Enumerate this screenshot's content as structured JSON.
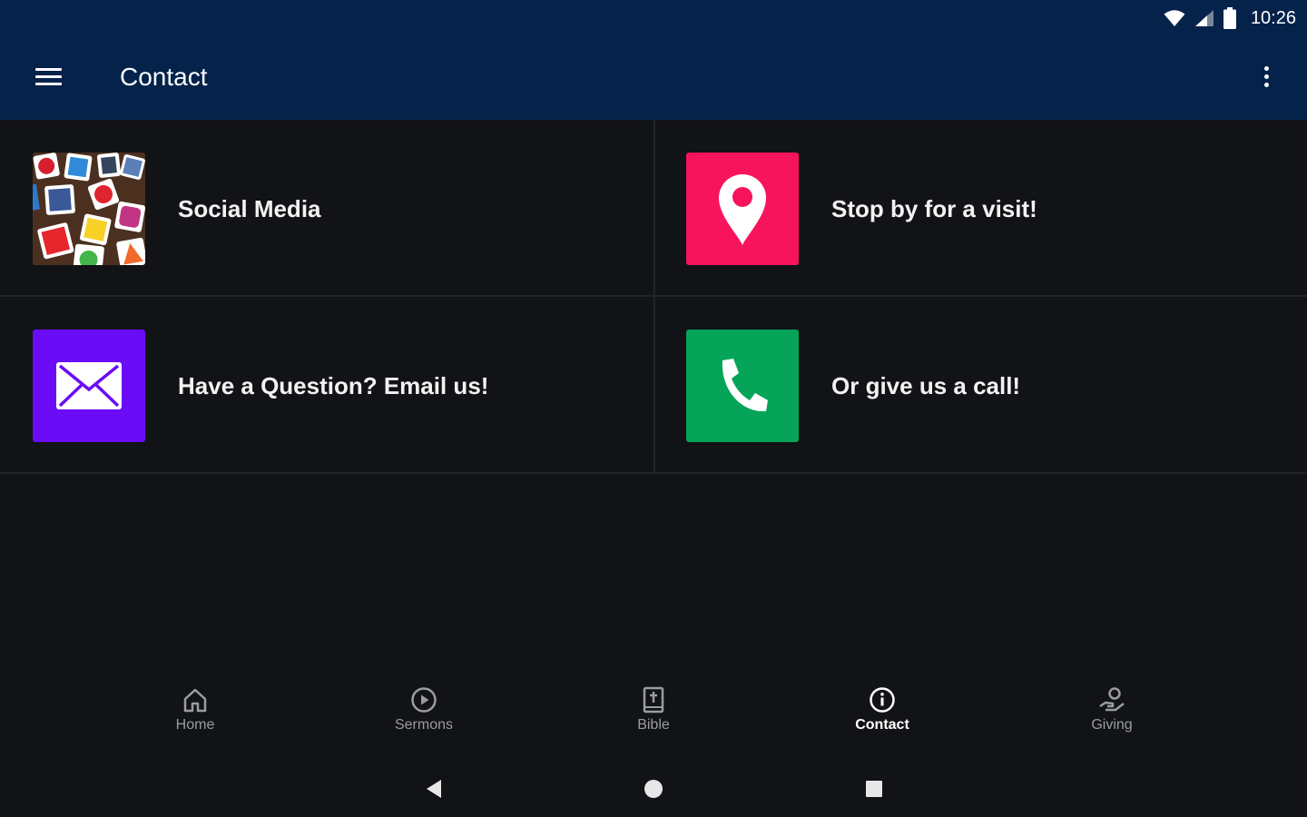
{
  "status_bar": {
    "time": "10:26",
    "icons": [
      "wifi-icon",
      "signal-icon",
      "battery-icon"
    ]
  },
  "app_bar": {
    "title": "Contact",
    "menu_icon": "menu-icon",
    "overflow_icon": "more-vert-icon"
  },
  "tiles": [
    {
      "label": "Social Media",
      "icon": "social-media-collage"
    },
    {
      "label": "Stop by for a visit!",
      "icon": "location-pin-icon",
      "color": "#f8145c"
    },
    {
      "label": "Have a Question? Email us!",
      "icon": "envelope-icon",
      "color": "#6a0cf6"
    },
    {
      "label": "Or give us a call!",
      "icon": "phone-icon",
      "color": "#05a458"
    }
  ],
  "bottom_nav": {
    "items": [
      {
        "label": "Home",
        "icon": "home-icon"
      },
      {
        "label": "Sermons",
        "icon": "play-circle-icon"
      },
      {
        "label": "Bible",
        "icon": "bible-icon"
      },
      {
        "label": "Contact",
        "icon": "info-icon",
        "active": true
      },
      {
        "label": "Giving",
        "icon": "giving-hand-icon"
      }
    ]
  },
  "system_nav": {
    "buttons": [
      "back-icon",
      "home-circle-icon",
      "recents-icon"
    ]
  },
  "colors": {
    "app_bar": "#04224a",
    "background": "#121316",
    "divider": "#22242a",
    "nav_inactive": "#9a9ca2"
  }
}
